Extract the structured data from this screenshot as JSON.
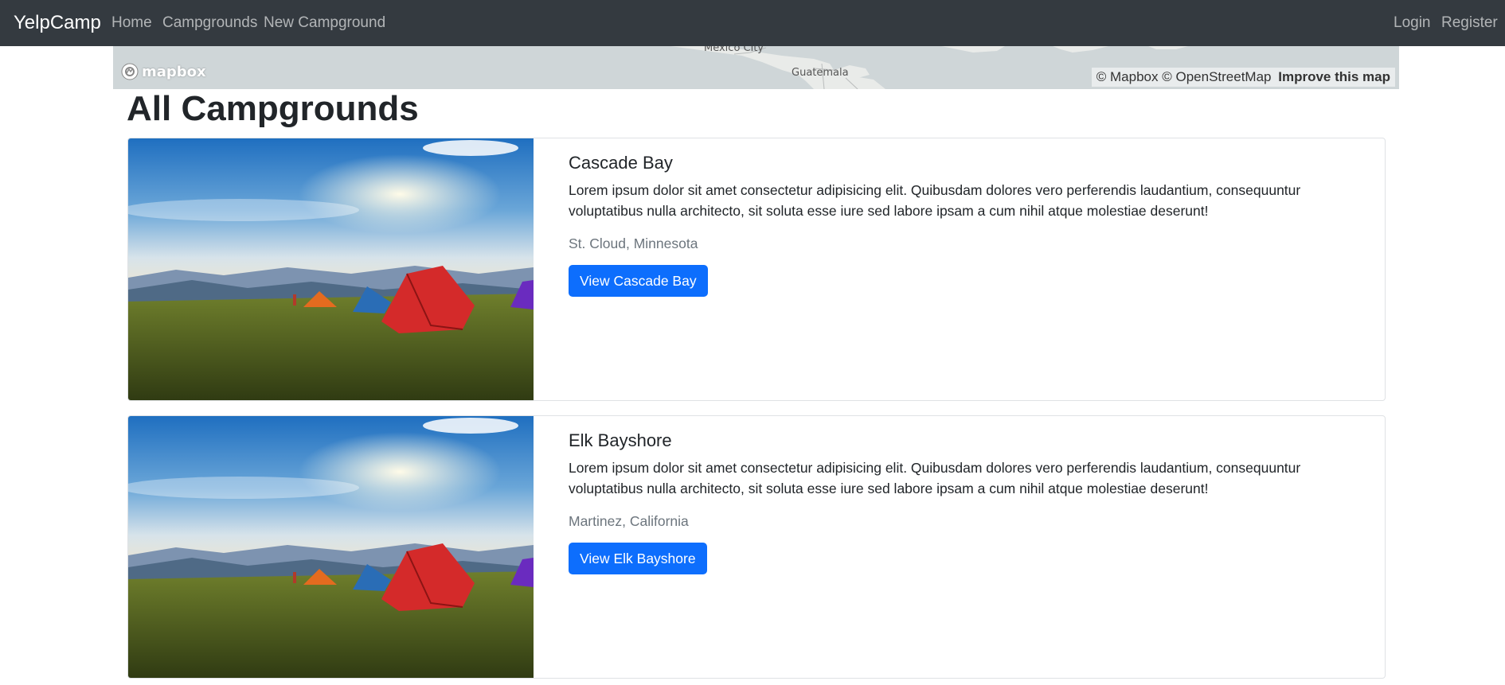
{
  "navbar": {
    "brand": "YelpCamp",
    "links": [
      "Home",
      "Campgrounds",
      "New Campground"
    ],
    "auth": [
      "Login",
      "Register"
    ]
  },
  "map": {
    "cities": [
      "Mexico City",
      "Guatemala"
    ],
    "logo_text": "mapbox",
    "attribution": [
      "© Mapbox",
      "© OpenStreetMap"
    ],
    "improve": "Improve this map"
  },
  "page": {
    "title": "All Campgrounds"
  },
  "campgrounds": [
    {
      "title": "Cascade Bay",
      "description": "Lorem ipsum dolor sit amet consectetur adipisicing elit. Quibusdam dolores vero perferendis laudantium, consequuntur voluptatibus nulla architecto, sit soluta esse iure sed labore ipsam a cum nihil atque molestiae deserunt!",
      "location": "St. Cloud, Minnesota",
      "button": "View Cascade Bay"
    },
    {
      "title": "Elk Bayshore",
      "description": "Lorem ipsum dolor sit amet consectetur adipisicing elit. Quibusdam dolores vero perferendis laudantium, consequuntur voluptatibus nulla architecto, sit soluta esse iure sed labore ipsam a cum nihil atque molestiae deserunt!",
      "location": "Martinez, California",
      "button": "View Elk Bayshore"
    }
  ],
  "colors": {
    "navbar_bg": "#343a40",
    "primary": "#0d6efd",
    "muted": "#6c757d",
    "map_water": "#cfd6d8"
  }
}
